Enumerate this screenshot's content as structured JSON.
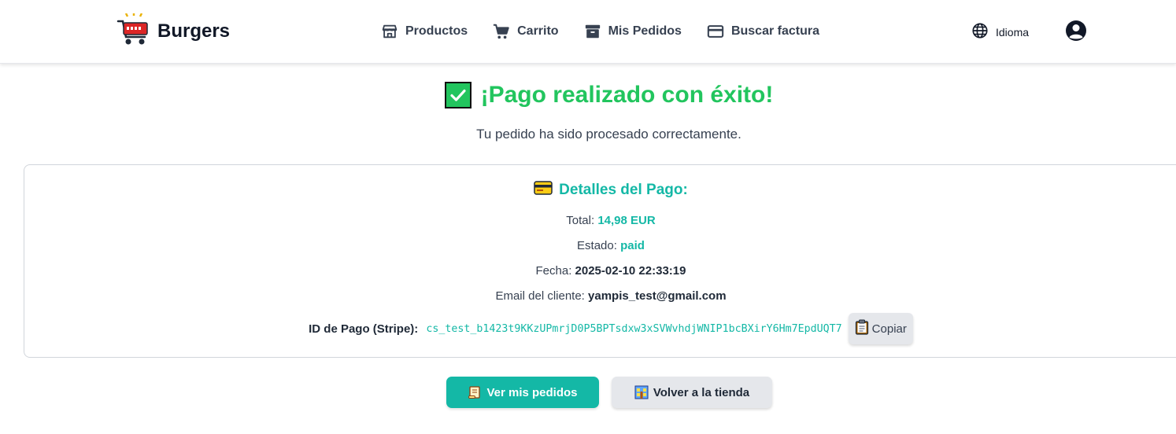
{
  "navbar": {
    "brand": "Burgers",
    "links": {
      "products": "Productos",
      "cart": "Carrito",
      "orders": "Mis Pedidos",
      "invoice": "Buscar factura"
    },
    "language": "Idioma",
    "icons": [
      "cart-logo-icon",
      "store-icon",
      "cart-icon",
      "archive-icon",
      "credit-card-icon",
      "globe-icon",
      "user-circle-icon"
    ]
  },
  "success": {
    "title": "¡Pago realizado con éxito!",
    "subtitle": "Tu pedido ha sido procesado correctamente.",
    "color": "#22c55e"
  },
  "details": {
    "heading": "Detalles del Pago:",
    "total_label": "Total:",
    "total_value": "14,98 EUR",
    "status_label": "Estado:",
    "status_value": "paid",
    "date_label": "Fecha:",
    "date_value": "2025-02-10 22:33:19",
    "email_label": "Email del cliente:",
    "email_value": "yampis_test@gmail.com",
    "id_label": "ID de Pago (Stripe):",
    "id_value": "cs_test_b1423t9KKzUPmrjD0P5BPTsdxw3xSVWvhdjWNIP1bcBXirY6Hm7EpdUQT7",
    "copy_label": "Copiar",
    "accent": "#14b8a6"
  },
  "actions": {
    "orders_label": "Ver mis pedidos",
    "store_label": "Volver a la tienda"
  }
}
